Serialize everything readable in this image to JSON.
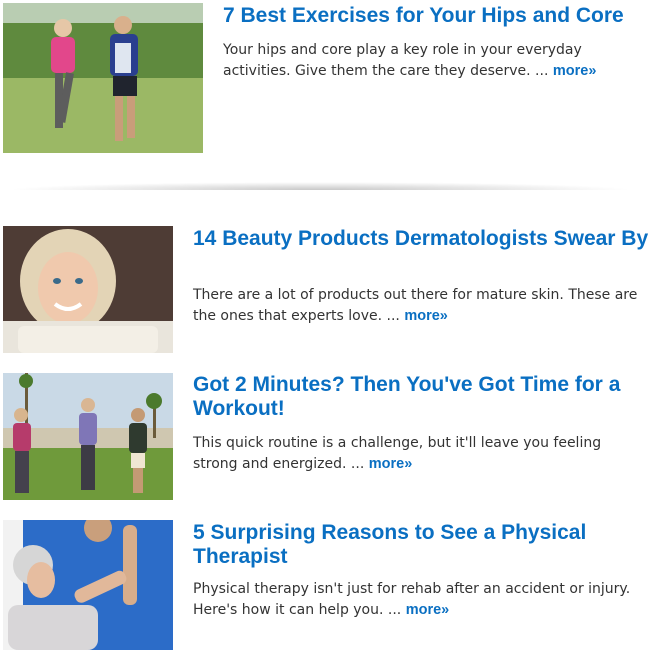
{
  "articles": [
    {
      "title": "7 Best Exercises for Your Hips and Core",
      "description": "Your hips and core play a key role in your everyday activities. Give them the care they deserve. ...",
      "more_label": "more»",
      "image_alt": "older couple jogging outdoors"
    },
    {
      "title": "14 Beauty Products Dermatologists Swear By",
      "description": "There are a lot of products out there for mature skin. These are the ones that experts love. ...",
      "more_label": "more»",
      "image_alt": "smiling mature woman in white sweater"
    },
    {
      "title": "Got 2 Minutes? Then You've Got Time for a Workout!",
      "description": "This quick routine is a challenge, but it'll leave you feeling strong and energized. ...",
      "more_label": "more»",
      "image_alt": "group of older women exercising outdoors"
    },
    {
      "title": "5 Surprising Reasons to See a Physical Therapist",
      "description": "Physical therapy isn't just for rehab after an accident or injury. Here's how it can help you. ...",
      "more_label": "more»",
      "image_alt": "physical therapist helping older woman"
    }
  ],
  "colors": {
    "link": "#0a6fc2",
    "body_text": "#333333"
  }
}
